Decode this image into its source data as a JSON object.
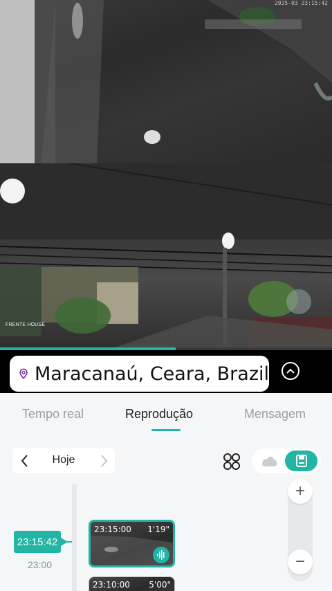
{
  "camera_1": {
    "timestamp": "2025-03  23:15:42"
  },
  "camera_2": {
    "label": "FRENTE HOUSE"
  },
  "playback": {
    "progress": 0.53
  },
  "location": {
    "text": "Maracanaú, Ceara, Brazil",
    "icon": "location-pin-icon"
  },
  "tabs": [
    {
      "label": "Tempo real",
      "active": false
    },
    {
      "label": "Reprodução",
      "active": true
    },
    {
      "label": "Mensagem",
      "active": false
    }
  ],
  "date_nav": {
    "label": "Hoje"
  },
  "timeline": {
    "current_time": "23:15:42",
    "tick_label": "23:00",
    "clips": [
      {
        "start": "23:15:00",
        "duration": "1'19\"",
        "selected": true,
        "audio": true
      },
      {
        "start": "23:10:00",
        "duration": "5'00\"",
        "selected": false,
        "audio": false
      }
    ]
  },
  "zoom": {
    "in_label": "+",
    "out_label": "−"
  },
  "colors": {
    "accent": "#21b5a5",
    "location_icon": "#7a2ea8"
  }
}
